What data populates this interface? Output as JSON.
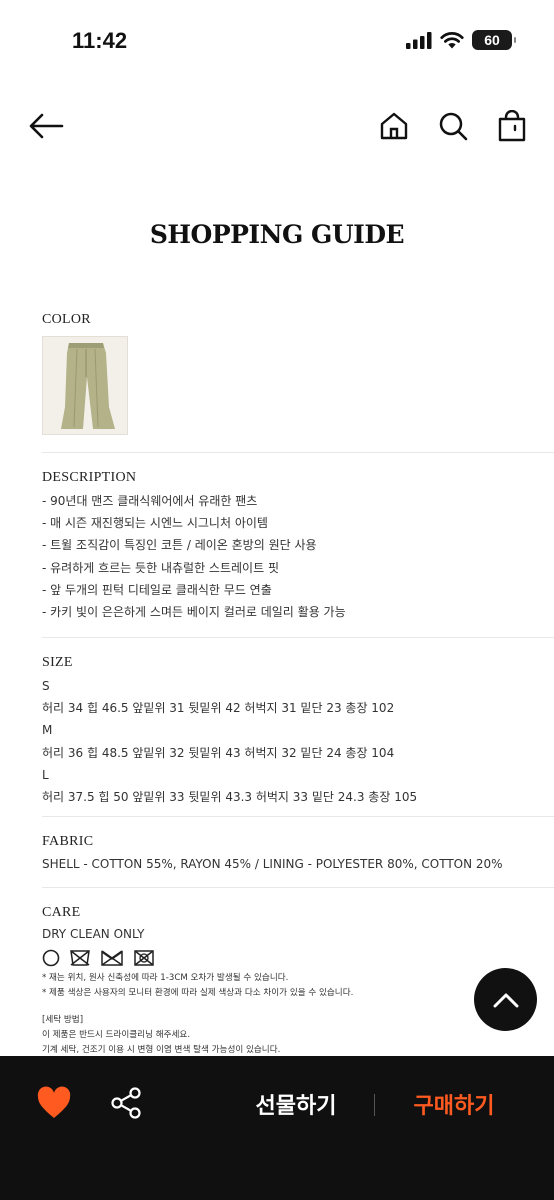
{
  "status_bar": {
    "time": "11:42",
    "battery": "60"
  },
  "colors": {
    "accent": "#ff5a1f",
    "bottom_bar": "#101010",
    "heart": "#ff5a1f",
    "swatch": "#b3b289"
  },
  "nav": {
    "back_icon": "arrow-left-icon",
    "home_icon": "home-icon",
    "search_icon": "search-icon",
    "bag_icon": "shopping-bag-icon"
  },
  "guide": {
    "title": "SHOPPING GUIDE",
    "color": {
      "heading": "COLOR"
    },
    "description": {
      "heading": "DESCRIPTION",
      "lines": [
        "- 90년대 맨즈 클래식웨어에서 유래한 팬츠",
        "- 매 시즌 재진행되는 시엔느 시그니처 아이템",
        "- 트윌 조직감이 특징인 코튼 / 레이온 혼방의 원단 사용",
        "- 유려하게 흐르는 듯한 내츄럴한 스트레이트 핏",
        "- 앞 두개의 핀턱 디테일로 클래식한 무드 연출",
        "- 카키 빛이 은은하게 스며든 베이지 컬러로 데일리 활용 가능"
      ]
    },
    "size": {
      "heading": "SIZE",
      "sizes": [
        {
          "label": "S",
          "measure": "허리 34  힙 46.5  앞밑위 31  뒷밑위 42  허벅지 31  밑단 23  총장 102"
        },
        {
          "label": "M",
          "measure": "허리 36  힙 48.5  앞밑위 32  뒷밑위 43  허벅지 32  밑단 24  총장 104"
        },
        {
          "label": "L",
          "measure": "허리 37.5  힙 50  앞밑위 33  뒷밑위 43.3  허벅지 33  밑단 24.3  총장 105"
        }
      ]
    },
    "fabric": {
      "heading": "FABRIC",
      "text": "SHELL - COTTON 55%, RAYON 45%  /  LINING - POLYESTER 80%, COTTON 20%"
    },
    "care": {
      "heading": "CARE",
      "method": "DRY CLEAN ONLY",
      "icons": [
        "no-wash-icon",
        "do-not-bleach-icon",
        "do-not-tumble-dry-icon",
        "do-not-iron-icon"
      ],
      "note1": "* 재는 위치, 원사 신축성에 따라 1-3CM 오차가 발생될 수 있습니다.",
      "note2": "* 제품 색상은 사용자의 모니터 환경에 따라 실제 색상과 다소 차이가 있을 수 있습니다.",
      "wash_heading": "[세탁 방법]",
      "wash1": "이 제품은 반드시 드라이클리닝 해주세요.",
      "wash2": "기계 세탁, 건조기 이용 시 변형 이염 변색 탈색 가능성이 있습니다."
    }
  },
  "scroll_top": {
    "icon": "chevron-up-icon"
  },
  "bottom_bar": {
    "like_icon": "heart-icon",
    "share_icon": "share-icon",
    "gift_label": "선물하기",
    "buy_label": "구매하기"
  }
}
